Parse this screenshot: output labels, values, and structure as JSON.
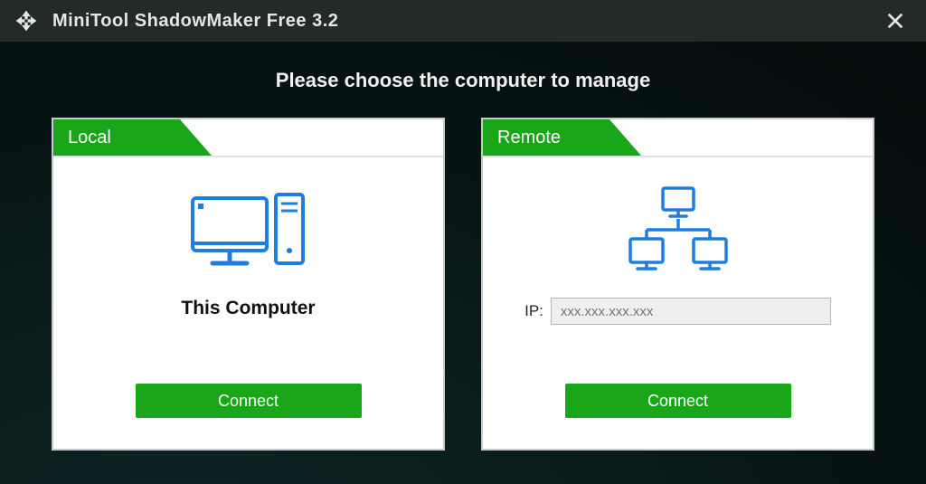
{
  "titlebar": {
    "app_title": "MiniTool ShadowMaker Free 3.2"
  },
  "prompt": "Please choose the computer to manage",
  "local": {
    "tab_label": "Local",
    "label": "This Computer",
    "connect_label": "Connect"
  },
  "remote": {
    "tab_label": "Remote",
    "ip_label": "IP:",
    "ip_placeholder": "xxx.xxx.xxx.xxx",
    "connect_label": "Connect"
  },
  "colors": {
    "accent_green": "#19a619",
    "icon_blue": "#1e7de0"
  }
}
